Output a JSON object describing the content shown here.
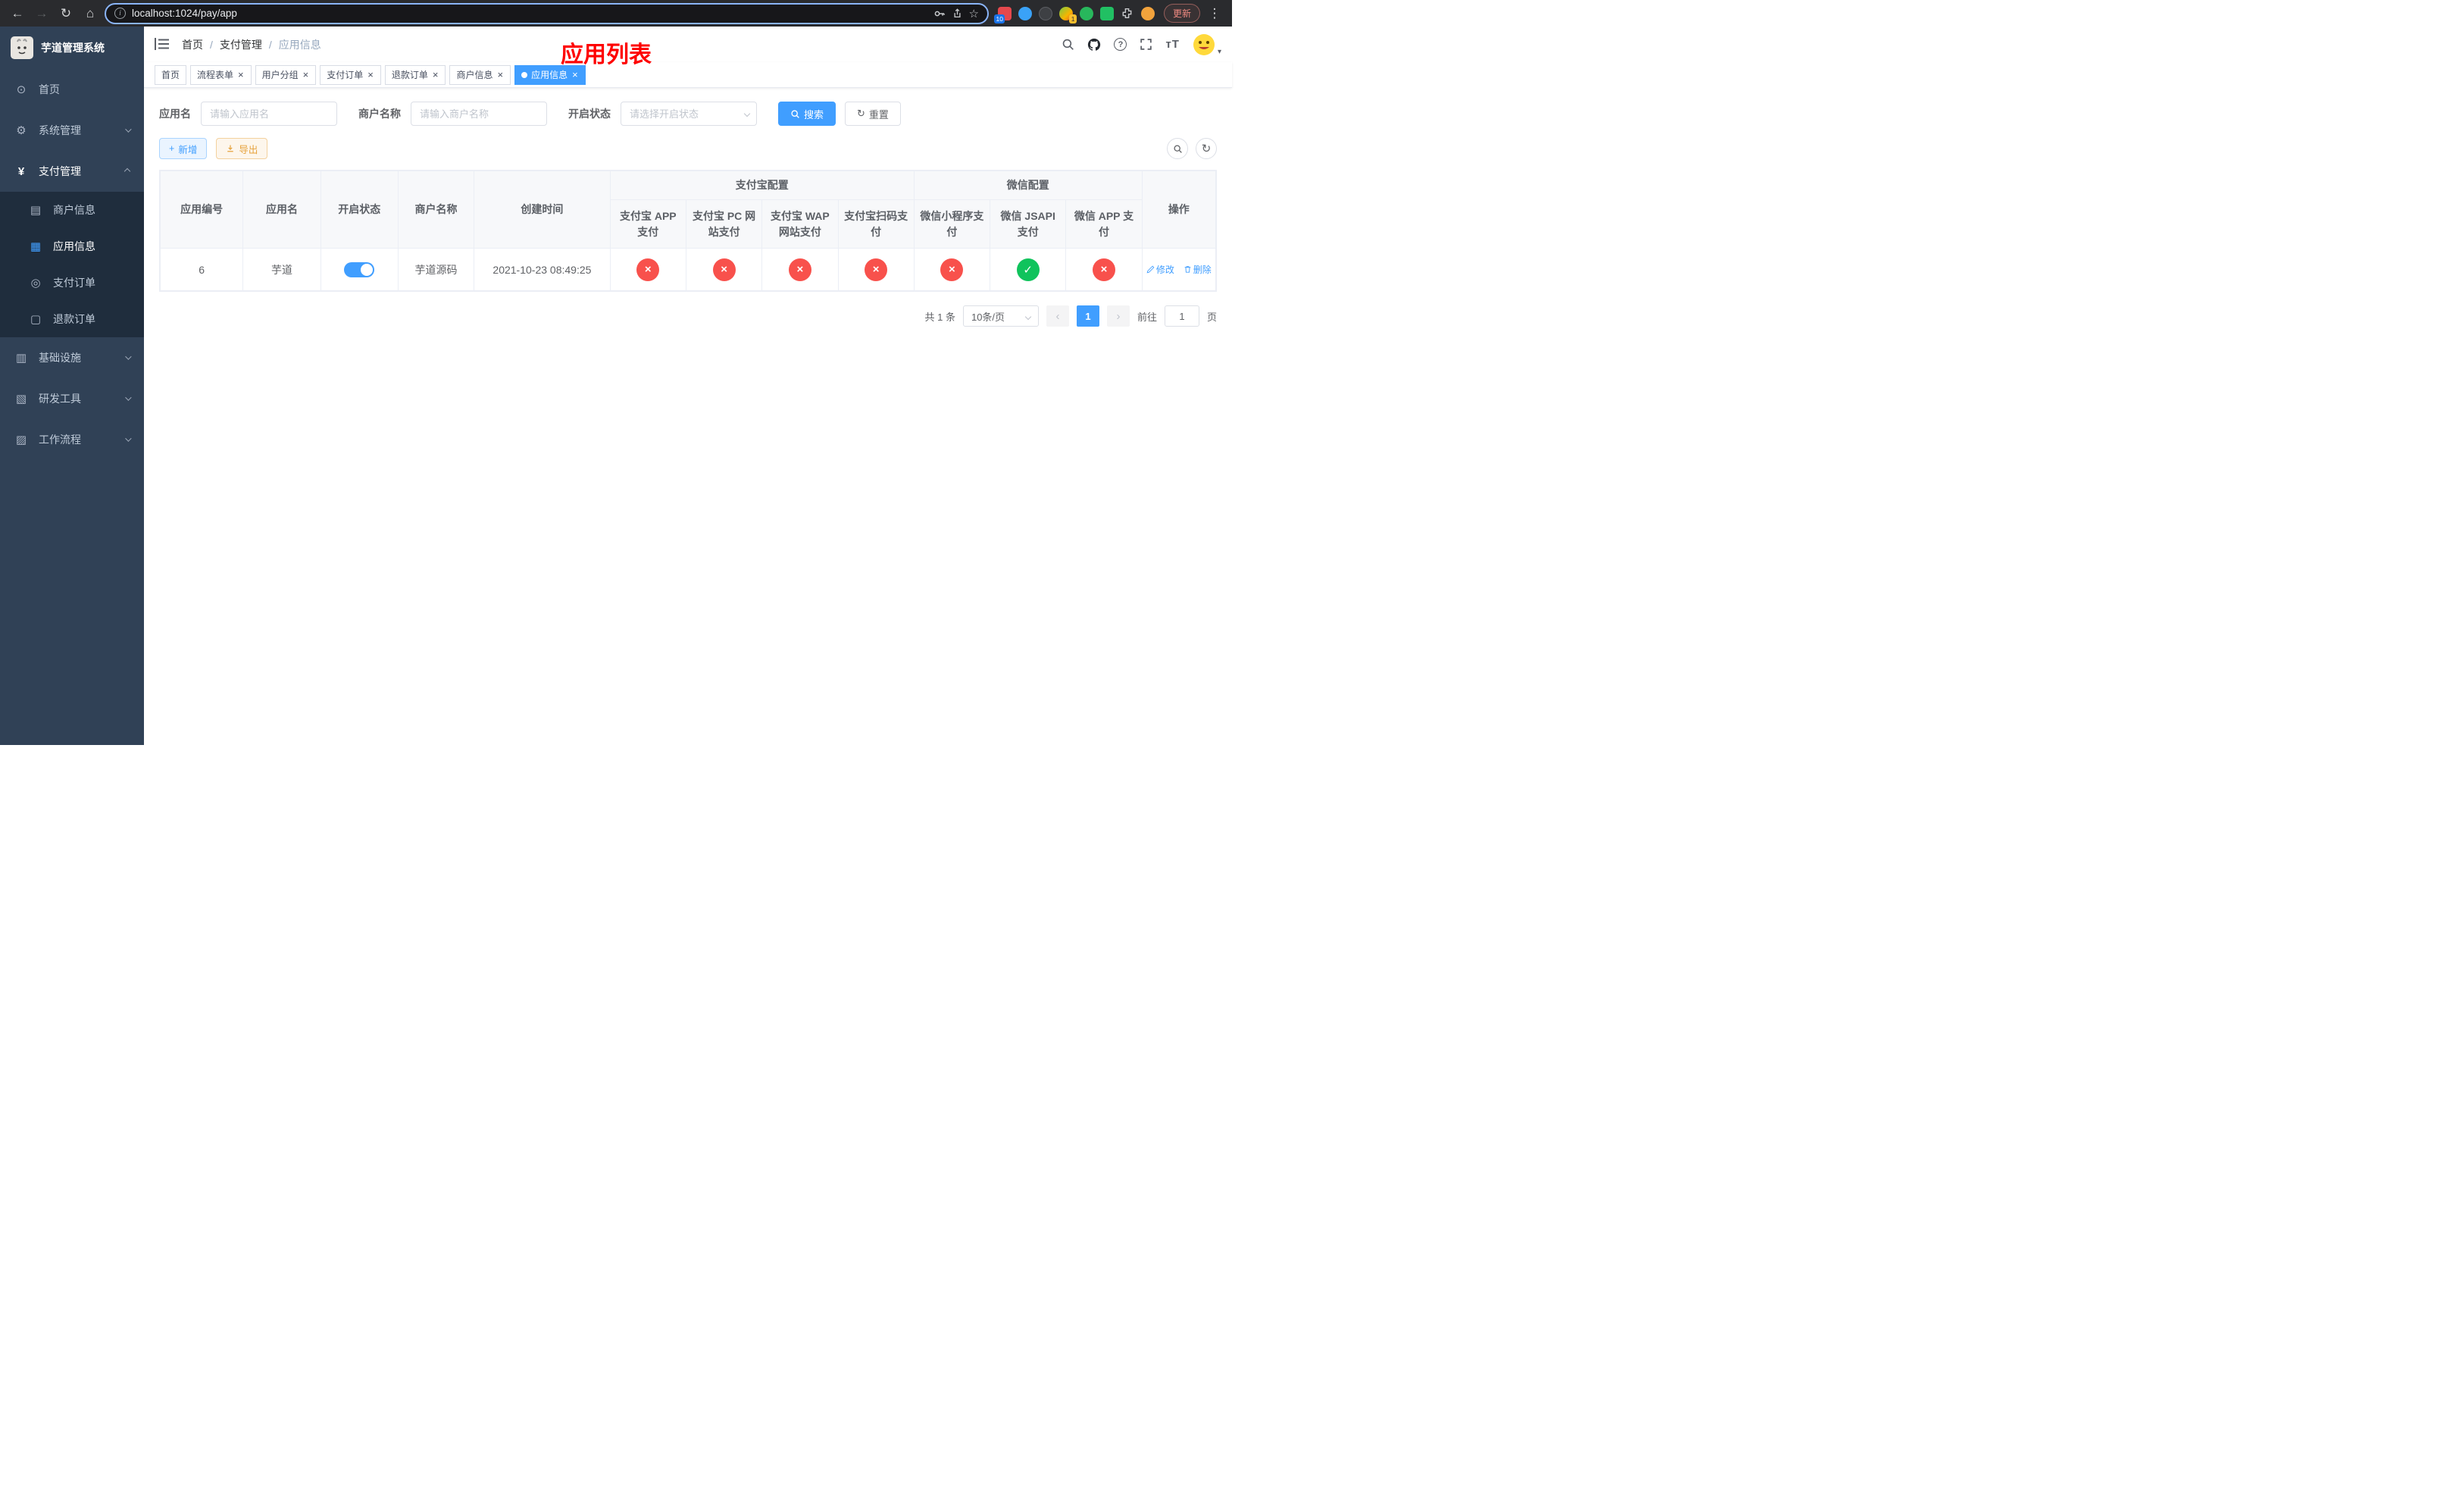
{
  "browser": {
    "url": "localhost:1024/pay/app",
    "update_label": "更新",
    "ext_badge_blue": "10",
    "ext_badge_yellow": "1"
  },
  "glyphs": {
    "back": "←",
    "forward": "→",
    "reload": "↻",
    "home": "⌂",
    "star": "☆",
    "menu_dots": "⋮",
    "help": "?",
    "close": "×",
    "check": "✓",
    "cross": "×",
    "prev": "‹",
    "next": "›",
    "caret": "▾",
    "plus": "+",
    "dashboard": "⊙",
    "gear": "⚙",
    "yen": "¥",
    "merchant": "▤",
    "app_info": "▦",
    "pay_order": "◎",
    "refund_order": "▢",
    "infra": "▥",
    "dev_tools": "▧",
    "workflow": "▨",
    "font_icon": "тT"
  },
  "sidebar": {
    "title": "芋道管理系统",
    "items": [
      {
        "label": "首页"
      },
      {
        "label": "系统管理"
      },
      {
        "label": "支付管理"
      },
      {
        "label": "基础设施"
      },
      {
        "label": "研发工具"
      },
      {
        "label": "工作流程"
      }
    ],
    "submenu": [
      {
        "label": "商户信息"
      },
      {
        "label": "应用信息"
      },
      {
        "label": "支付订单"
      },
      {
        "label": "退款订单"
      }
    ]
  },
  "header": {
    "breadcrumb": [
      "首页",
      "支付管理",
      "应用信息"
    ],
    "overlay_title": "应用列表"
  },
  "tabs": [
    {
      "label": "首页",
      "closable": false,
      "active": false
    },
    {
      "label": "流程表单",
      "closable": true,
      "active": false
    },
    {
      "label": "用户分组",
      "closable": true,
      "active": false
    },
    {
      "label": "支付订单",
      "closable": true,
      "active": false
    },
    {
      "label": "退款订单",
      "closable": true,
      "active": false
    },
    {
      "label": "商户信息",
      "closable": true,
      "active": false
    },
    {
      "label": "应用信息",
      "closable": true,
      "active": true
    }
  ],
  "filters": {
    "app_name_label": "应用名",
    "app_name_placeholder": "请输入应用名",
    "merchant_label": "商户名称",
    "merchant_placeholder": "请输入商户名称",
    "status_label": "开启状态",
    "status_placeholder": "请选择开启状态",
    "search_label": "搜索",
    "reset_label": "重置"
  },
  "toolbar": {
    "add_label": "新增",
    "export_label": "导出"
  },
  "table": {
    "groups": {
      "alipay": "支付宝配置",
      "wechat": "微信配置"
    },
    "columns": [
      "应用编号",
      "应用名",
      "开启状态",
      "商户名称",
      "创建时间",
      "支付宝 APP 支付",
      "支付宝 PC 网站支付",
      "支付宝 WAP 网站支付",
      "支付宝扫码支付",
      "微信小程序支付",
      "微信 JSAPI 支付",
      "微信 APP 支付",
      "操作"
    ],
    "rows": [
      {
        "app_id": "6",
        "app_name": "芋道",
        "enabled": true,
        "merchant": "芋道源码",
        "created": "2021-10-23 08:49:25",
        "configs": [
          false,
          false,
          false,
          false,
          false,
          true,
          false
        ],
        "edit_label": "修改",
        "delete_label": "删除"
      }
    ]
  },
  "pagination": {
    "total_label": "共 1 条",
    "page_size_label": "10条/页",
    "current_page": "1",
    "goto_prefix": "前往",
    "goto_value": "1",
    "goto_suffix": "页"
  }
}
